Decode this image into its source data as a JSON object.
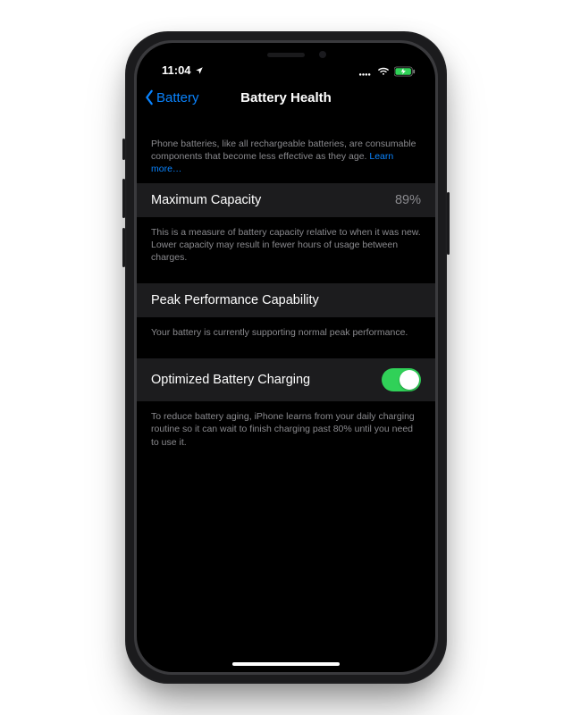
{
  "status": {
    "time": "11:04",
    "location_icon": true
  },
  "nav": {
    "back_label": "Battery",
    "title": "Battery Health"
  },
  "intro": {
    "text": "Phone batteries, like all rechargeable batteries, are consumable components that become less effective as they age. ",
    "link": "Learn more…"
  },
  "max_capacity": {
    "label": "Maximum Capacity",
    "value": "89%",
    "footer": "This is a measure of battery capacity relative to when it was new. Lower capacity may result in fewer hours of usage between charges."
  },
  "peak": {
    "label": "Peak Performance Capability",
    "footer": "Your battery is currently supporting normal peak performance."
  },
  "optimized": {
    "label": "Optimized Battery Charging",
    "enabled": true,
    "footer": "To reduce battery aging, iPhone learns from your daily charging routine so it can wait to finish charging past 80% until you need to use it."
  }
}
